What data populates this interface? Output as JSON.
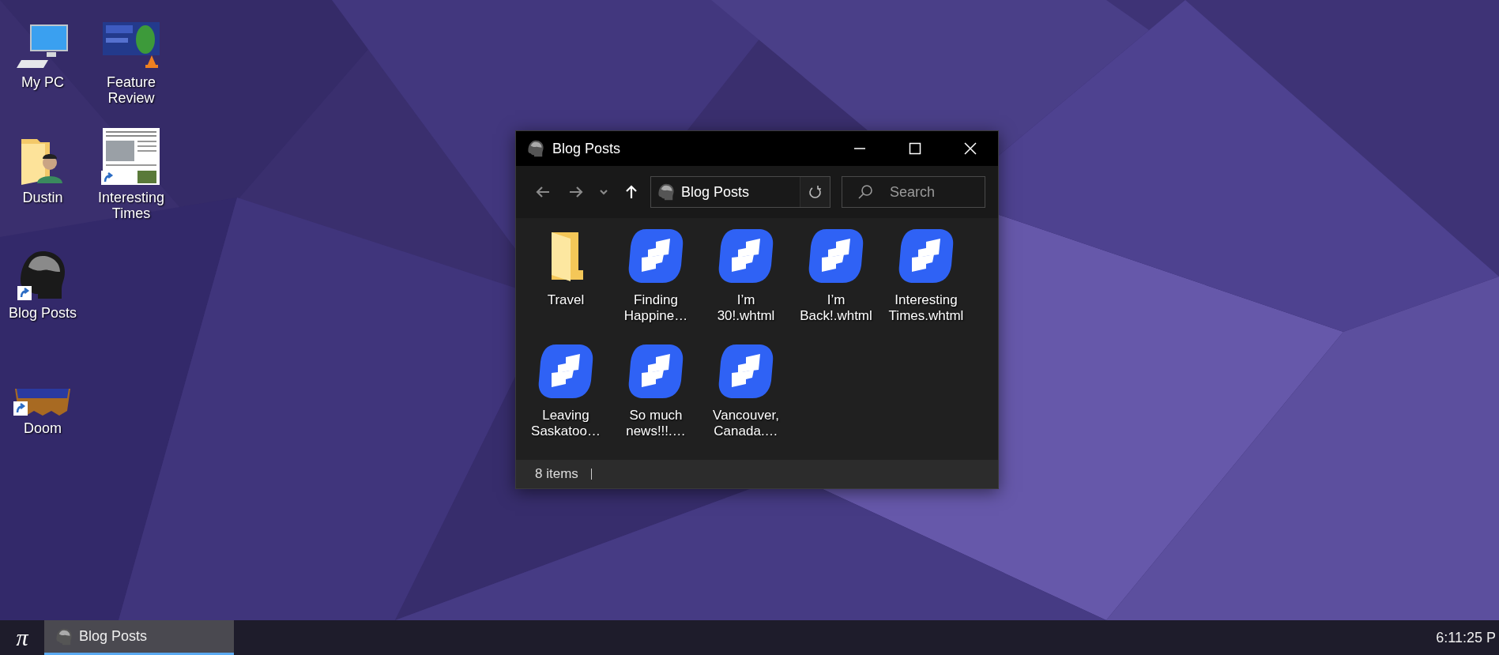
{
  "desktop_icons": [
    {
      "label": "My PC",
      "kind": "computer",
      "shortcut": false
    },
    {
      "label": "Dustin",
      "kind": "user-folder",
      "shortcut": false
    },
    {
      "label": "Blog Posts",
      "kind": "head",
      "shortcut": true
    },
    {
      "label": "Doom",
      "kind": "game",
      "shortcut": true
    },
    {
      "label": "Feature Review",
      "kind": "thumbnail",
      "shortcut": false
    },
    {
      "label": "Interesting Times",
      "kind": "document",
      "shortcut": true
    }
  ],
  "window": {
    "title": "Blog Posts",
    "nav_buttons": [
      {
        "kind": "back",
        "disabled": true
      },
      {
        "kind": "forward",
        "disabled": true
      },
      {
        "kind": "recent",
        "disabled": true
      },
      {
        "kind": "up",
        "disabled": false
      }
    ],
    "address": {
      "value": "Blog Posts"
    },
    "search": {
      "placeholder": "Search"
    },
    "items": [
      {
        "lines": [
          "Travel"
        ],
        "kind": "folder"
      },
      {
        "lines": [
          "Finding",
          "Happine…"
        ],
        "kind": "web-file"
      },
      {
        "lines": [
          "I’m",
          "30!.whtml"
        ],
        "kind": "web-file"
      },
      {
        "lines": [
          "I’m",
          "Back!.whtml"
        ],
        "kind": "web-file"
      },
      {
        "lines": [
          "Interesting",
          "Times.whtml"
        ],
        "kind": "web-file"
      },
      {
        "lines": [
          "Leaving",
          "Saskatoo…"
        ],
        "kind": "web-file"
      },
      {
        "lines": [
          "So much",
          "news!!!.…"
        ],
        "kind": "web-file"
      },
      {
        "lines": [
          "Vancouver,",
          "Canada.…"
        ],
        "kind": "web-file"
      }
    ],
    "status_bar": {
      "count": "8 items"
    }
  },
  "taskbar": {
    "start": "π",
    "apps": [
      {
        "label": "Blog Posts",
        "selected": true
      }
    ],
    "clock": "6:11:25 P"
  }
}
